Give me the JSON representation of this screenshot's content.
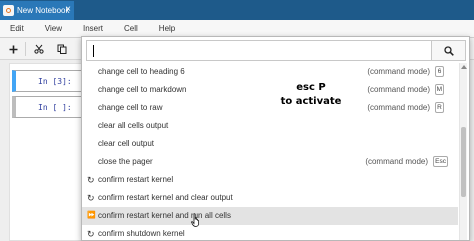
{
  "browser": {
    "tab_title": "New Notebook",
    "tab_close": "×"
  },
  "menu": [
    "Edit",
    "View",
    "Insert",
    "Cell",
    "Help"
  ],
  "toolbar": {
    "icons": [
      "plus-icon",
      "scissors-icon",
      "copy-icon"
    ]
  },
  "notebook": {
    "cells": [
      {
        "prompt": "In [3]:"
      },
      {
        "prompt": "In [ ]:"
      }
    ]
  },
  "palette": {
    "search_value": "",
    "commands": [
      {
        "icon": "",
        "label": "change cell to heading 6",
        "mode": "(command mode)",
        "key": "6"
      },
      {
        "icon": "",
        "label": "change cell to markdown",
        "mode": "(command mode)",
        "key": "M"
      },
      {
        "icon": "",
        "label": "change cell to raw",
        "mode": "(command mode)",
        "key": "R"
      },
      {
        "icon": "",
        "label": "clear all cells output",
        "mode": "",
        "key": ""
      },
      {
        "icon": "",
        "label": "clear cell output",
        "mode": "",
        "key": ""
      },
      {
        "icon": "",
        "label": "close the pager",
        "mode": "(command mode)",
        "key": "Esc"
      },
      {
        "icon": "↻",
        "label": "confirm restart kernel",
        "mode": "",
        "key": ""
      },
      {
        "icon": "↻",
        "label": "confirm restart kernel and clear output",
        "mode": "",
        "key": ""
      },
      {
        "icon": "⏩",
        "label": "confirm restart kernel and run all cells",
        "mode": "",
        "key": ""
      },
      {
        "icon": "↻",
        "label": "confirm shutdown kernel",
        "mode": "",
        "key": ""
      }
    ],
    "hovered_index": 8
  },
  "annotation": {
    "line1": "esc P",
    "line2": "to activate"
  },
  "colors": {
    "tab_active": "#2a78b8",
    "tabstrip": "#1e5a8a",
    "cell_accent": "#42a5f5",
    "prompt": "#303f9f",
    "hover_row": "#e3e3e3"
  }
}
